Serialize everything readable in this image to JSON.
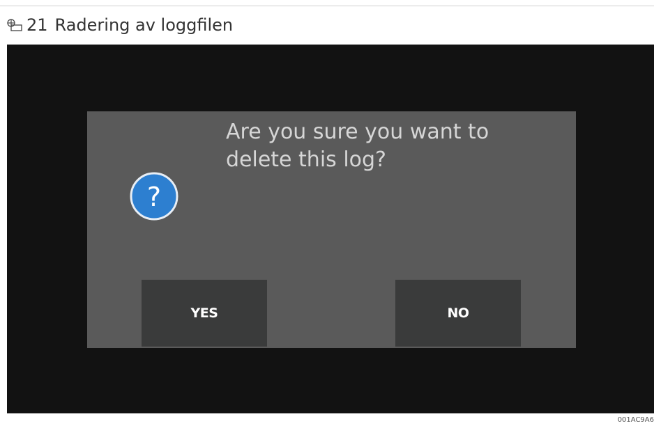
{
  "caption": {
    "number": "21",
    "title": "Radering av loggfilen"
  },
  "dialog": {
    "message": "Are you sure you want to\ndelete this log?",
    "icon": "question-icon",
    "yes_label": "YES",
    "no_label": "NO"
  },
  "figure_id": "001AC9A6",
  "colors": {
    "screen_background": "#121212",
    "dialog_background": "#5a5a5a",
    "button_background": "#3a3b3b",
    "icon_blue": "#2d7fd0",
    "message_text": "#d6d6d6"
  }
}
